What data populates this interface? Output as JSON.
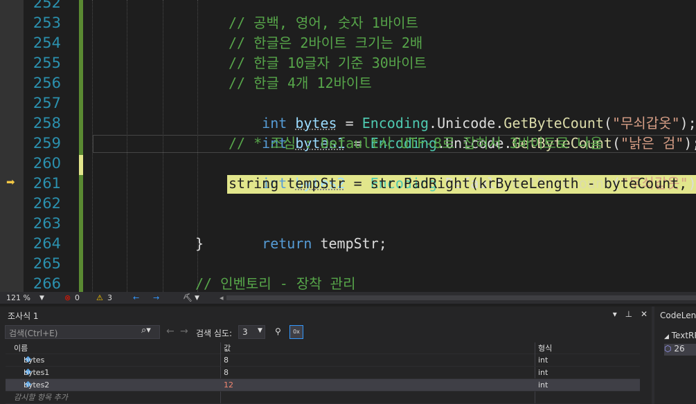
{
  "editor": {
    "line_numbers": [
      "252",
      "253",
      "254",
      "255",
      "256",
      "257",
      "258",
      "259",
      "260",
      "261",
      "262",
      "263",
      "264",
      "265",
      "266"
    ],
    "lines": {
      "l253": "// 공백, 영어, 숫자 1바이트",
      "l254": "// 한글은 2바이트 크기는 2배",
      "l255": "// 한글 10글자 기준 30바이트",
      "l256": "// 한글 4개 12바이트",
      "l257": {
        "kw": "int",
        "var": "bytes",
        "eq": " = ",
        "t1": "Encoding",
        "dot1": ".",
        "p1": "Unicode",
        "dot2": ".",
        "fn": "GetByteCount",
        "open": "(",
        "str": "\"무쇠갑옷\"",
        "close": ");"
      },
      "l258": {
        "kw": "int",
        "var": "bytes1",
        "eq": " = ",
        "t1": "Encoding",
        "dot1": ".",
        "p1": "Unicode",
        "dot2": ".",
        "fn": "GetByteCount",
        "open": "(",
        "str": "\"낡은 검\"",
        "close": ");"
      },
      "l259": "// * 조심 : Default시 UTF-8로 잡혀서 3바이트로 나옴",
      "l260": {
        "kw": "int",
        "var": "bytes2",
        "eq": " = ",
        "t1": "Encoding",
        "dot1": ".",
        "p1": "Default",
        "dot2": ".",
        "fn": "GetByteCount",
        "open": "(",
        "str": "\"무쇠갑옷\"",
        "close": ");"
      },
      "l261": "string tempStr = str.PadRight(krByteLength - byteCount,",
      "l263_kw": "return",
      "l263_rest": " tempStr;",
      "l264": "}",
      "l266": "// 인벤토리 - 장착 관리"
    },
    "exec_arrow": "➡"
  },
  "status": {
    "zoom": "121 %",
    "errors": "0",
    "warnings": "3"
  },
  "watch": {
    "title": "조사식 1",
    "search_placeholder": "검색(Ctrl+E)",
    "depth_label": "검색 심도:",
    "depth_value": "3",
    "columns": {
      "name": "이름",
      "value": "값",
      "type": "형식"
    },
    "rows": [
      {
        "name": "bytes",
        "value": "8",
        "type": "int"
      },
      {
        "name": "bytes1",
        "value": "8",
        "type": "int"
      },
      {
        "name": "bytes2",
        "value": "12",
        "type": "int"
      }
    ],
    "add_item": "감시할 항목 추가"
  },
  "codelens": {
    "title": "CodeLens",
    "item": "TextRPG",
    "sub": "26"
  }
}
